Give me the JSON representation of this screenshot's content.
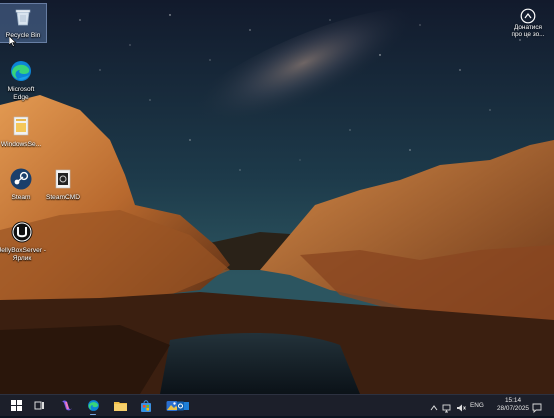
{
  "desktop": {
    "icons": [
      {
        "label": "Recycle Bin",
        "icon": "recycle-bin-icon"
      },
      {
        "label": "Microsoft Edge",
        "icon": "edge-icon"
      },
      {
        "label": "WindowsSe...",
        "icon": "folder-icon"
      },
      {
        "label": "Steam",
        "icon": "steam-icon"
      },
      {
        "label": "SteamCMD",
        "icon": "steamcmd-icon"
      },
      {
        "label": "JellyBoxServer - Ярлик",
        "icon": "jellybox-icon"
      }
    ],
    "notification_widget": {
      "label": "Донатися про це зо...",
      "icon": "donate-icon"
    }
  },
  "taskbar": {
    "apps": [
      {
        "name": "start",
        "icon": "windows-start-icon"
      },
      {
        "name": "task-view",
        "icon": "task-view-icon"
      },
      {
        "name": "copilot",
        "icon": "copilot-icon"
      },
      {
        "name": "edge",
        "icon": "edge-icon",
        "active": true
      },
      {
        "name": "file-explorer",
        "icon": "folder-icon"
      },
      {
        "name": "store",
        "icon": "store-icon"
      },
      {
        "name": "photos",
        "icon": "photos-icon"
      },
      {
        "name": "outlook",
        "icon": "outlook-icon"
      }
    ],
    "tray": {
      "language": "ENG",
      "time": "15:14",
      "date": "28/07/2025"
    }
  },
  "colors": {
    "taskbar": "#1c1f2a",
    "accent": "#7aa7e0"
  }
}
